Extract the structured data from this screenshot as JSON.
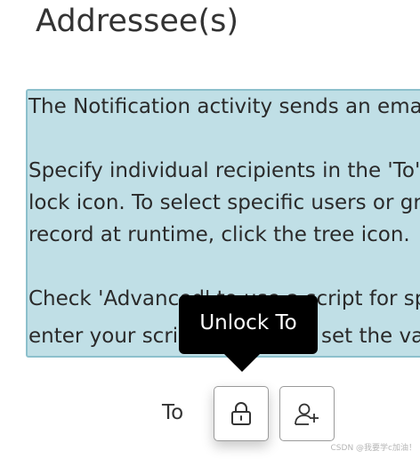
{
  "section": {
    "title": "Addressee(s)"
  },
  "info": {
    "lines": [
      "The Notification activity sends an email or",
      "Specify individual recipients in the 'To' fiel",
      "lock icon. To select specific users or groups",
      "record at runtime, click the tree icon.",
      "Check 'Advanced' to use a script for specifi",
      "enter your script",
      "set the vari"
    ]
  },
  "tooltip": {
    "text": "Unlock To"
  },
  "to_field": {
    "label": "To",
    "lock_icon": "lock-icon",
    "tree_icon": "add-user-tree-icon"
  },
  "watermark": {
    "text": "CSDN @我要学c加油！"
  },
  "colors": {
    "info_background": "#c0dfe6",
    "info_border": "#8cc0cc",
    "tooltip_background": "#000000",
    "tooltip_text": "#ffffff"
  }
}
